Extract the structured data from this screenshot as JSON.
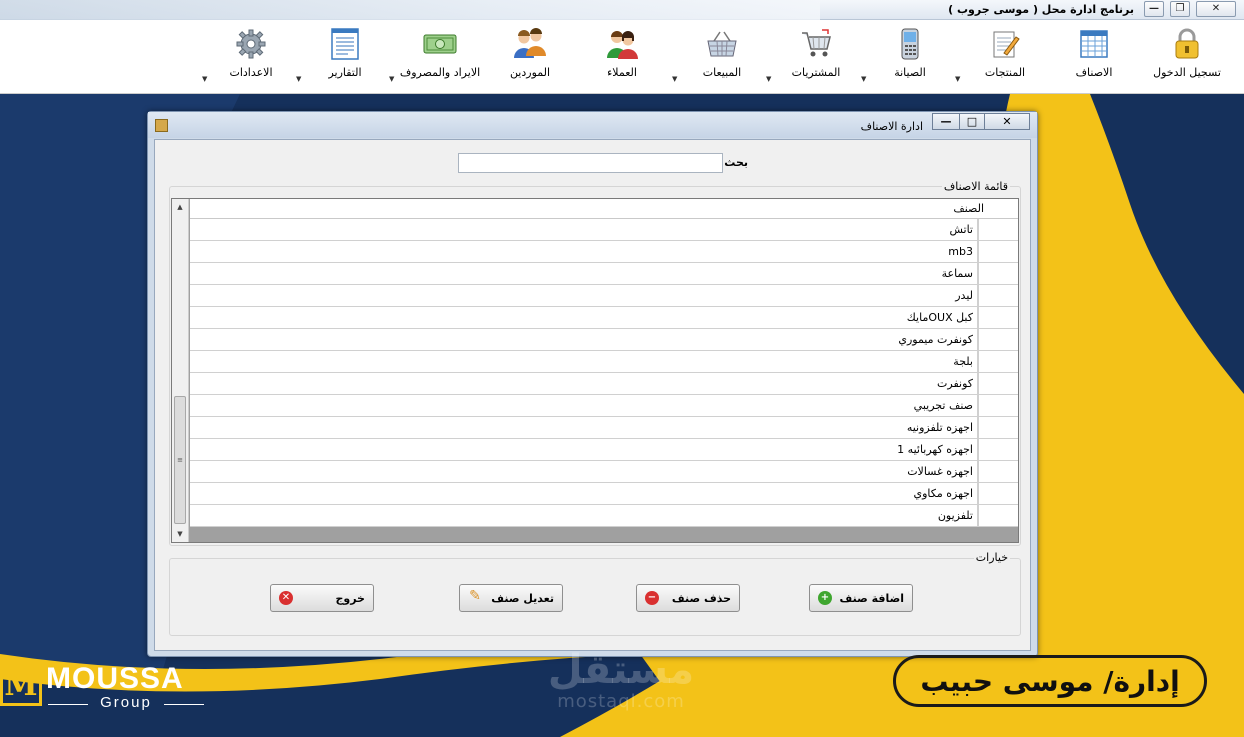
{
  "window": {
    "title": "برنامج ادارة محل ( موسى جروب )",
    "close": "✕",
    "maximize": "❐",
    "minimize": "—"
  },
  "toolbar": {
    "items": [
      {
        "label": "تسجيل الدخول",
        "icon": "lock-icon"
      },
      {
        "label": "الاصناف",
        "icon": "grid-icon"
      },
      {
        "label": "المنتجات",
        "icon": "notepad-icon"
      },
      {
        "label": "الصيانة",
        "icon": "phone-icon"
      },
      {
        "label": "المشتريات",
        "icon": "cart-icon"
      },
      {
        "label": "المبيعات",
        "icon": "basket-icon"
      },
      {
        "label": "العملاء",
        "icon": "customers-icon"
      },
      {
        "label": "الموردين",
        "icon": "suppliers-icon"
      },
      {
        "label": "الايراد والمصروف",
        "icon": "money-icon"
      },
      {
        "label": "التقارير",
        "icon": "report-icon"
      },
      {
        "label": "الاعدادات",
        "icon": "gear-icon"
      }
    ]
  },
  "dialog": {
    "title": "ادارة الاصناف",
    "close": "✕",
    "maximize": "□",
    "minimize": "—",
    "search_label": "بحث",
    "search_value": "",
    "list_group_title": "قائمة الاصناف",
    "column_header": "الصنف",
    "rows": [
      "تاتش",
      "mb3",
      "سماعة",
      "ليدر",
      "كبل OUXمايك",
      "كونفرت ميموري",
      "بلجة",
      "كونفرت",
      "صنف تجريبي",
      "اجهزه تلفزونيه",
      "اجهزه كهربائيه 1",
      "اجهزه غسالات",
      "اجهزه مكاوي",
      "تلفزيون"
    ],
    "options_group_title": "خيارات",
    "buttons": {
      "add": "اضافة صنف",
      "delete": "حذف صنف",
      "edit": "تعديل صنف",
      "exit": "خروج"
    }
  },
  "branding": {
    "left_name": "MOUSSA",
    "left_sub": "Group",
    "left_letter": "M",
    "right_text": "إدارة/ موسى حبيب",
    "watermark_ar": "مستقل",
    "watermark_en": "mostaql.com"
  },
  "colors": {
    "brand_yellow": "#f3c218",
    "brand_navy": "#15305b"
  }
}
